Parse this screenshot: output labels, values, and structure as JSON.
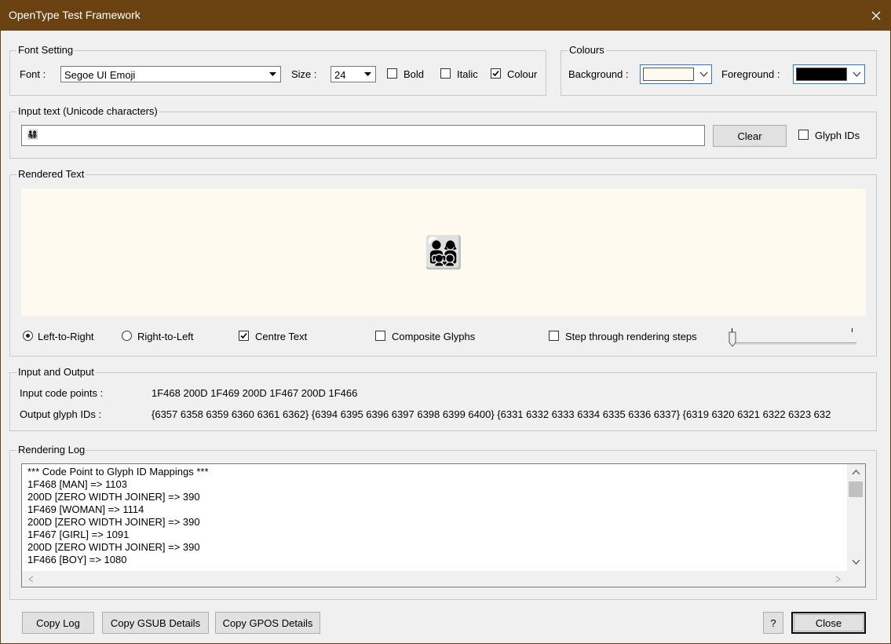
{
  "window": {
    "title": "OpenType Test Framework"
  },
  "font_setting": {
    "legend": "Font Setting",
    "font_label": "Font :",
    "font_value": "Segoe UI Emoji",
    "size_label": "Size :",
    "size_value": "24",
    "bold_label": "Bold",
    "bold_checked": false,
    "italic_label": "Italic",
    "italic_checked": false,
    "colour_label": "Colour",
    "colour_checked": true
  },
  "colours": {
    "legend": "Colours",
    "background_label": "Background :",
    "background_color": "#fffaf0",
    "foreground_label": "Foreground :",
    "foreground_color": "#000000"
  },
  "input_text": {
    "legend": "Input text (Unicode characters)",
    "value": "👨‍👩‍👧‍👦",
    "clear_label": "Clear",
    "glyph_ids_label": "Glyph IDs",
    "glyph_ids_checked": false
  },
  "rendered_text": {
    "legend": "Rendered Text",
    "text": "👨‍👩‍👧‍👦",
    "ltr_label": "Left-to-Right",
    "ltr_selected": true,
    "rtl_label": "Right-to-Left",
    "rtl_selected": false,
    "centre_label": "Centre Text",
    "centre_checked": true,
    "composite_label": "Composite Glyphs",
    "composite_checked": false,
    "step_label": "Step through rendering steps",
    "step_checked": false,
    "slider_value": 0
  },
  "io": {
    "legend": "Input and Output",
    "input_label": "Input code points :",
    "input_value": "1F468 200D 1F469 200D 1F467 200D 1F466",
    "output_label": "Output glyph IDs :",
    "output_value": "{6357 6358 6359 6360 6361 6362} {6394 6395 6396 6397 6398 6399 6400} {6331 6332 6333 6334 6335 6336 6337} {6319 6320 6321 6322 6323 632"
  },
  "log": {
    "legend": "Rendering Log",
    "lines": [
      "*** Code Point to Glyph ID Mappings ***",
      "1F468 [MAN] => 1103",
      "200D [ZERO WIDTH JOINER] => 390",
      "1F469 [WOMAN] => 1114",
      "200D [ZERO WIDTH JOINER] => 390",
      "1F467 [GIRL] => 1091",
      "200D [ZERO WIDTH JOINER] => 390",
      "1F466 [BOY] => 1080"
    ]
  },
  "buttons": {
    "copy_log": "Copy Log",
    "copy_gsub": "Copy GSUB Details",
    "copy_gpos": "Copy GPOS Details",
    "help": "?",
    "close": "Close"
  }
}
